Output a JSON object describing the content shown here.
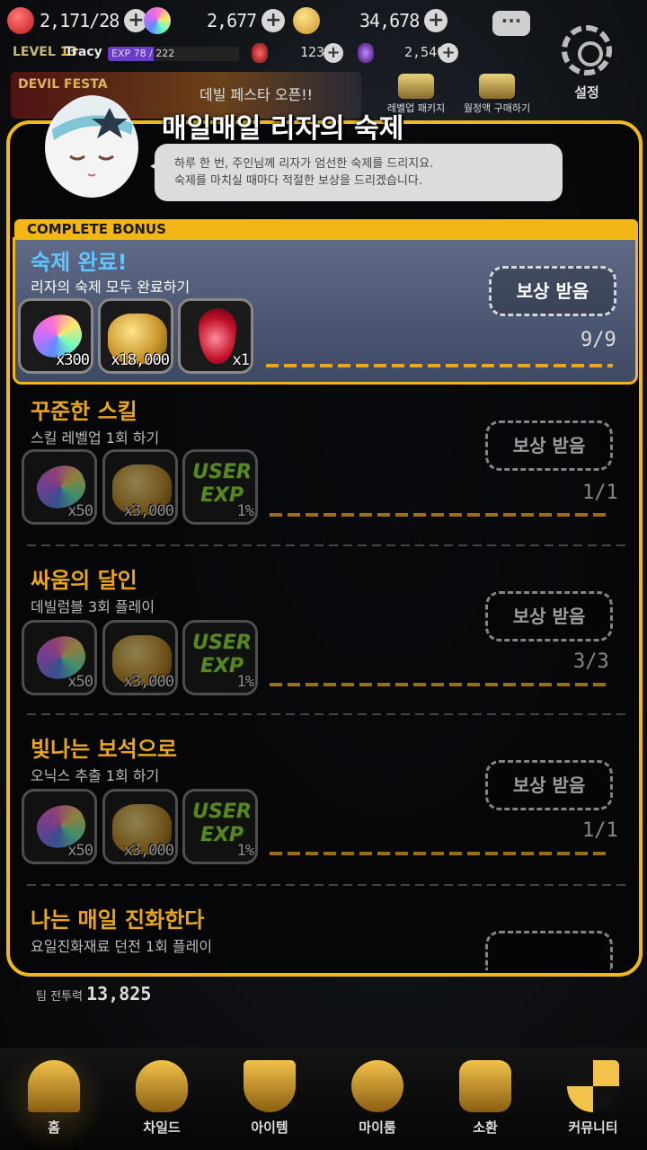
{
  "currency": {
    "hearts": "2,171/28",
    "gems": "2,677",
    "gold": "34,678"
  },
  "player": {
    "level_label": "LEVEL",
    "level": "13",
    "name": "Tracy",
    "exp_text": "EXP 78 / 222",
    "exp_fraction": 0.35,
    "red_stones": "123",
    "purple_stones": "2,540"
  },
  "banner": {
    "devil_festa": "DEVIL FESTA",
    "festa_text": "데빌 페스타 오픈!!"
  },
  "shop": {
    "item1": "레벨업 패키지",
    "item2": "월정액 구매하기"
  },
  "settings_label": "설정",
  "popup": {
    "title": "매일매일 리자의 숙제",
    "speech_line1": "하루 한 번, 주인님께 리자가 엄선한 숙제를 드리지요.",
    "speech_line2": "숙제를 마치실 때마다 적절한 보상을 드리겠습니다.",
    "bonus_tag": "COMPLETE BONUS",
    "bonus": {
      "title": "숙제 완료!",
      "desc": "리자의 숙제 모두 완료하기",
      "rewards": [
        "x300",
        "x18,000",
        "x1"
      ],
      "button": "보상 받음",
      "progress": "9/9"
    },
    "quests": [
      {
        "title": "꾸준한 스킬",
        "desc": "스킬 레벨업 1회 하기",
        "rewards": [
          "x50",
          "x3,000",
          "1%"
        ],
        "button": "보상 받음",
        "progress": "1/1"
      },
      {
        "title": "싸움의 달인",
        "desc": "데빌럼블 3회 플레이",
        "rewards": [
          "x50",
          "x3,000",
          "1%"
        ],
        "button": "보상 받음",
        "progress": "3/3"
      },
      {
        "title": "빛나는 보석으로",
        "desc": "오닉스 추출 1회 하기",
        "rewards": [
          "x50",
          "x3,000",
          "1%"
        ],
        "button": "보상 받음",
        "progress": "1/1"
      },
      {
        "title": "나는 매일 진화한다",
        "desc": "요일진화재료 던전 1회 플레이"
      }
    ]
  },
  "team_power_label": "팀 전투력",
  "team_power": "13,825",
  "nav": [
    "홈",
    "차일드",
    "아이템",
    "마이룸",
    "소환",
    "커뮤니티"
  ]
}
